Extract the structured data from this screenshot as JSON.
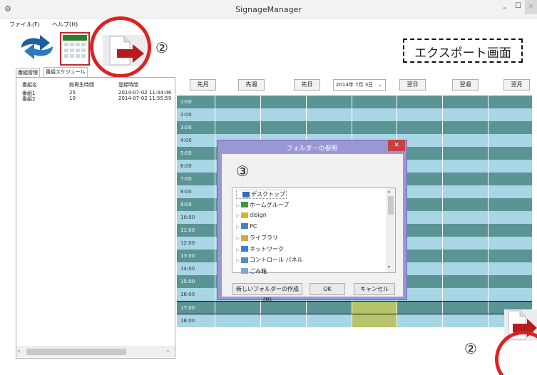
{
  "window": {
    "title": "SignageManager",
    "icon": "app-icon"
  },
  "menu": [
    {
      "label": "ファイル(F)"
    },
    {
      "label": "ヘルプ(H)"
    }
  ],
  "toolbar": {
    "annotation_number": "②",
    "export_label": "エクスポート画面",
    "buttons": [
      "refresh-icon",
      "calendar-icon",
      "export-icon"
    ]
  },
  "tabs": [
    {
      "label": "番組管理",
      "active": false
    },
    {
      "label": "番組スケジュール",
      "active": true
    }
  ],
  "program_list": {
    "headers": [
      "番組名",
      "総再生時間",
      "登録時間"
    ],
    "rows": [
      [
        "番組1",
        "25",
        "2014-07-02 11:44:46"
      ],
      [
        "番組2",
        "10",
        "2014-07-02 11:55:59"
      ]
    ]
  },
  "nav": {
    "prev_month": "先月",
    "prev_week": "先週",
    "prev_day": "先日",
    "date": "2014年 7月 3日",
    "next_day": "翌日",
    "next_week": "翌週",
    "next_month": "翌月"
  },
  "schedule": {
    "times": [
      "1:00",
      "2:00",
      "3:00",
      "4:00",
      "5:00",
      "6:00",
      "7:00",
      "8:00",
      "9:00",
      "10:00",
      "11:00",
      "12:00",
      "13:00",
      "14:00",
      "15:00",
      "16:00",
      "17:00",
      "18:00"
    ],
    "colors": {
      "dark": "#5a9494",
      "light": "#a9d6e5",
      "highlight": "#b5c46a"
    }
  },
  "dialog": {
    "title": "フォルダーの参照",
    "annotation_number": "③",
    "tree": [
      {
        "label": "デスクトップ",
        "icon": "desktop-icon",
        "arrow": ""
      },
      {
        "label": "ホームグループ",
        "icon": "homegroup-icon",
        "arrow": "▷"
      },
      {
        "label": "disign",
        "icon": "user-folder-icon",
        "arrow": "▷"
      },
      {
        "label": "PC",
        "icon": "pc-icon",
        "arrow": "▷"
      },
      {
        "label": "ライブラリ",
        "icon": "library-icon",
        "arrow": "▷"
      },
      {
        "label": "ネットワーク",
        "icon": "network-icon",
        "arrow": "▷"
      },
      {
        "label": "コントロール パネル",
        "icon": "control-panel-icon",
        "arrow": "▷"
      },
      {
        "label": "ごみ箱",
        "icon": "recycle-bin-icon",
        "arrow": ""
      }
    ],
    "new_folder": "新しいフォルダーの作成(N)",
    "ok": "OK",
    "cancel": "キャンセル"
  },
  "bottom": {
    "annotation_number": "②"
  }
}
